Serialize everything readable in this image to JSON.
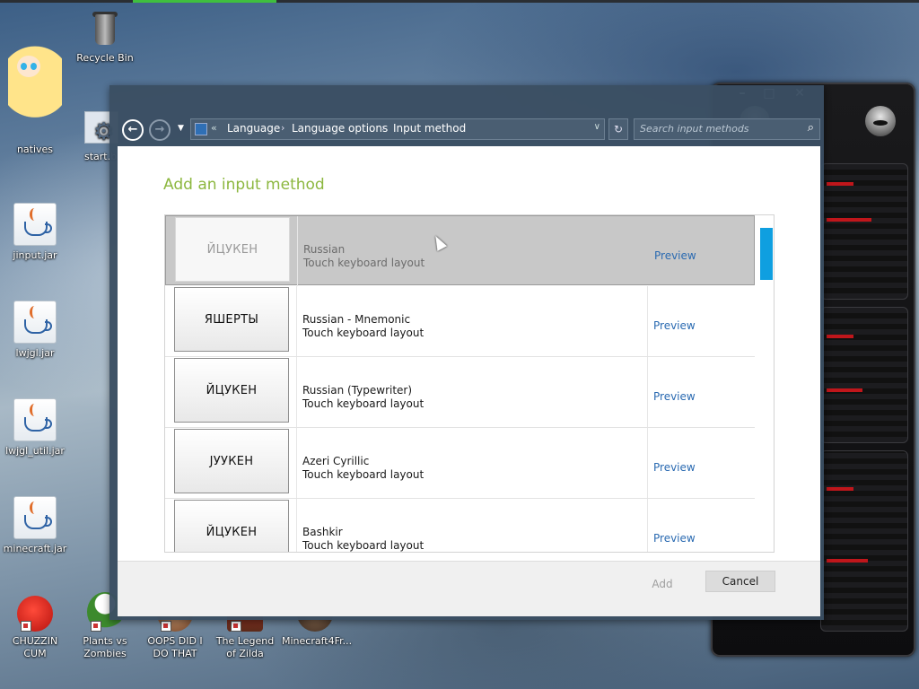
{
  "desktop": {
    "icons": [
      {
        "label": "Recycle Bin",
        "icon": "recycle-bin-icon"
      },
      {
        "label": "natives",
        "icon": "star-character-icon"
      },
      {
        "label": "start.b",
        "icon": "gear-file-icon"
      },
      {
        "label": "jinput.jar",
        "icon": "java-icon"
      },
      {
        "label": "lwjgl.jar",
        "icon": "java-icon"
      },
      {
        "label": "lwjgl_util.jar",
        "icon": "java-icon"
      },
      {
        "label": "minecraft.jar",
        "icon": "java-icon"
      }
    ],
    "bottom_icons": [
      {
        "label": "CHUZZIN CUM",
        "icon": "chuzzle-icon",
        "color": "#e0201c"
      },
      {
        "label": "Plants vs Zombies",
        "icon": "plants-vs-zombies-icon",
        "color": "#3c8a2d"
      },
      {
        "label": "OOPS DID I DO THAT",
        "icon": "game-icon",
        "color": "#7a4a2a"
      },
      {
        "label": "The Legend of Zilda",
        "icon": "game-icon",
        "color": "#c0372a"
      },
      {
        "label": "Minecraft4Fr...",
        "icon": "game-icon",
        "color": "#5a4030"
      }
    ]
  },
  "gadget": {
    "controls": {
      "minimize": "–",
      "maximize": "□",
      "close": "✕"
    },
    "accent": "#c0161b"
  },
  "explorer": {
    "nav": {
      "back_icon": "back-arrow-icon",
      "forward_icon": "forward-arrow-icon",
      "recent_icon": "chevron-down-icon"
    },
    "breadcrumb": {
      "overflow": "«",
      "items": [
        "Language",
        "Language options",
        "Input method"
      ]
    },
    "search": {
      "placeholder": "Search input methods"
    }
  },
  "dialog": {
    "title": "Add an input method",
    "title_color": "#8cb73f",
    "preview_label": "Preview",
    "items": [
      {
        "keyboard": "ЙЦУКЕН",
        "name": "Russian",
        "type": "Touch keyboard layout",
        "selected": true
      },
      {
        "keyboard": "ЯШЕРТЫ",
        "name": "Russian - Mnemonic",
        "type": "Touch keyboard layout",
        "selected": false
      },
      {
        "keyboard": "ЙЦУКЕН",
        "name": "Russian (Typewriter)",
        "type": "Touch keyboard layout",
        "selected": false
      },
      {
        "keyboard": "JУУКЕН",
        "name": "Azeri Cyrillic",
        "type": "Touch keyboard layout",
        "selected": false
      },
      {
        "keyboard": "ЙЦУКЕН",
        "name": "Bashkir",
        "type": "Touch keyboard layout",
        "selected": false
      }
    ],
    "buttons": {
      "add": "Add",
      "cancel": "Cancel"
    },
    "scroll_accent": "#0f9fe0"
  }
}
